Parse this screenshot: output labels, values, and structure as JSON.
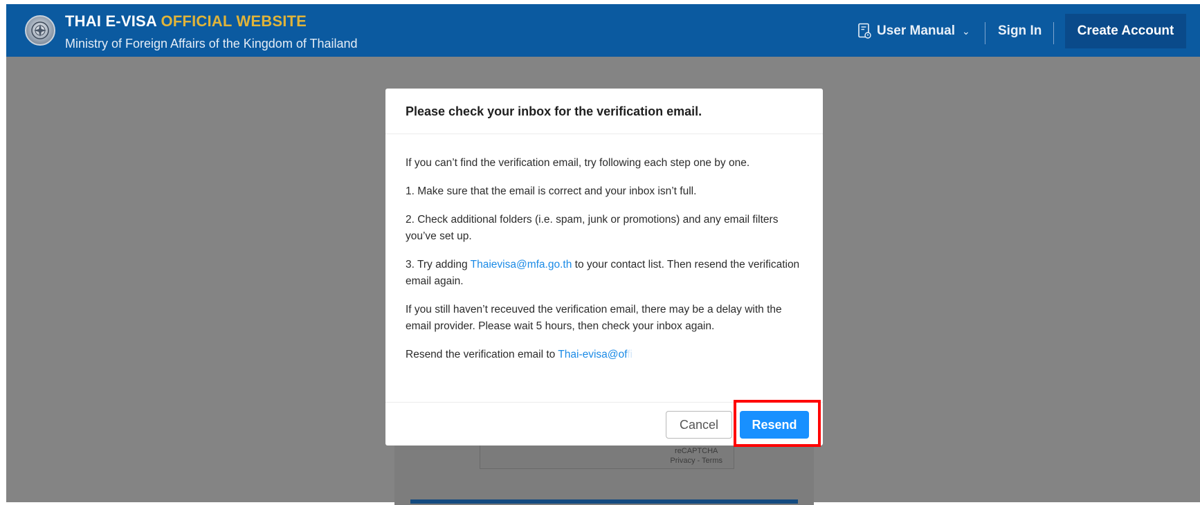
{
  "header": {
    "title_main": "THAI E-VISA",
    "title_accent": "OFFICIAL WEBSITE",
    "subtitle": "Ministry of Foreign Affairs of the Kingdom of Thailand",
    "nav": {
      "user_manual": "User Manual",
      "sign_in": "Sign In",
      "create_account": "Create Account"
    }
  },
  "modal": {
    "title": "Please check your inbox for the verification email.",
    "intro": "If you can’t find the verification email, try following each step one by one.",
    "step1": "1. Make sure that the email is correct and your inbox isn’t full.",
    "step2": "2. Check additional folders (i.e. spam, junk or promotions) and any email filters you’ve set up.",
    "step3_prefix": "3. Try adding",
    "step3_email": "Thaievisa@mfa.go.th",
    "step3_suffix": "to your contact list. Then resend the verification email again.",
    "delay_note": "If you still haven’t receuved the verification email, there may be a delay with the email provider. Please wait 5 hours, then check your inbox again.",
    "resend_prefix": "Resend the verification email to",
    "resend_email": "Thai-evisa@of",
    "resend_email_rest": "fi",
    "cancel_label": "Cancel",
    "resend_label": "Resend"
  },
  "recaptcha": {
    "label": "reCAPTCHA",
    "links": "Privacy - Terms"
  },
  "colors": {
    "header_bg": "#0b5aa0",
    "accent": "#e0b43a",
    "primary_button": "#1890ff",
    "link": "#1a8ae6",
    "highlight": "#ff0000"
  }
}
